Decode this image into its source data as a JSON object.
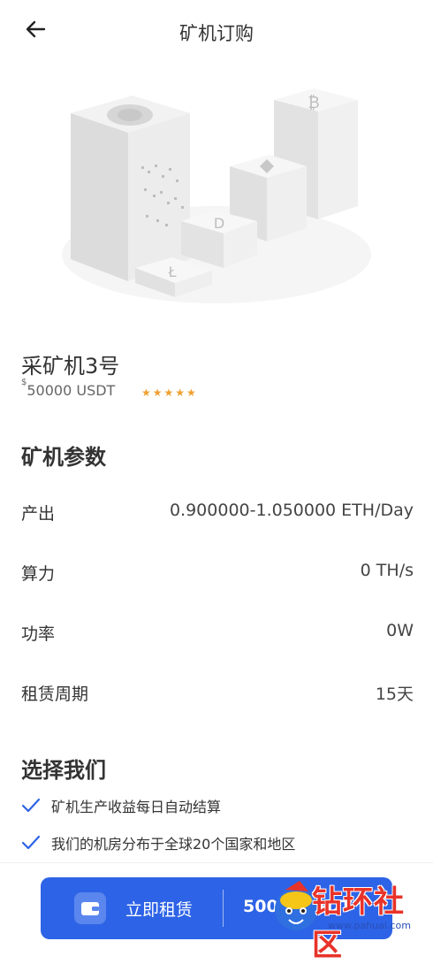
{
  "header": {
    "title": "矿机订购",
    "back_icon": "arrow-left-icon"
  },
  "product": {
    "name": "采矿机3号",
    "price_symbol": "$",
    "price": "50000 USDT",
    "stars": "★★★★★",
    "rating": 5
  },
  "params": {
    "title": "矿机参数",
    "rows": [
      {
        "label": "产出",
        "value": "0.900000-1.050000 ETH/Day"
      },
      {
        "label": "算力",
        "value": "0 TH/s"
      },
      {
        "label": "功率",
        "value": "0W"
      },
      {
        "label": "租赁周期",
        "value": "15天"
      }
    ]
  },
  "why": {
    "title": "选择我们",
    "items": [
      "矿机生产收益每日自动结算",
      "我们的机房分布于全球20个国家和地区"
    ]
  },
  "footer": {
    "rent_label": "立即租赁",
    "price": "500… USDT",
    "wallet_icon": "wallet-icon"
  },
  "watermark": {
    "text": "钻环社区",
    "url": "www.pahuai.com"
  },
  "colors": {
    "accent": "#2d63e6",
    "star": "#f0a030",
    "check": "#2d63e6"
  }
}
